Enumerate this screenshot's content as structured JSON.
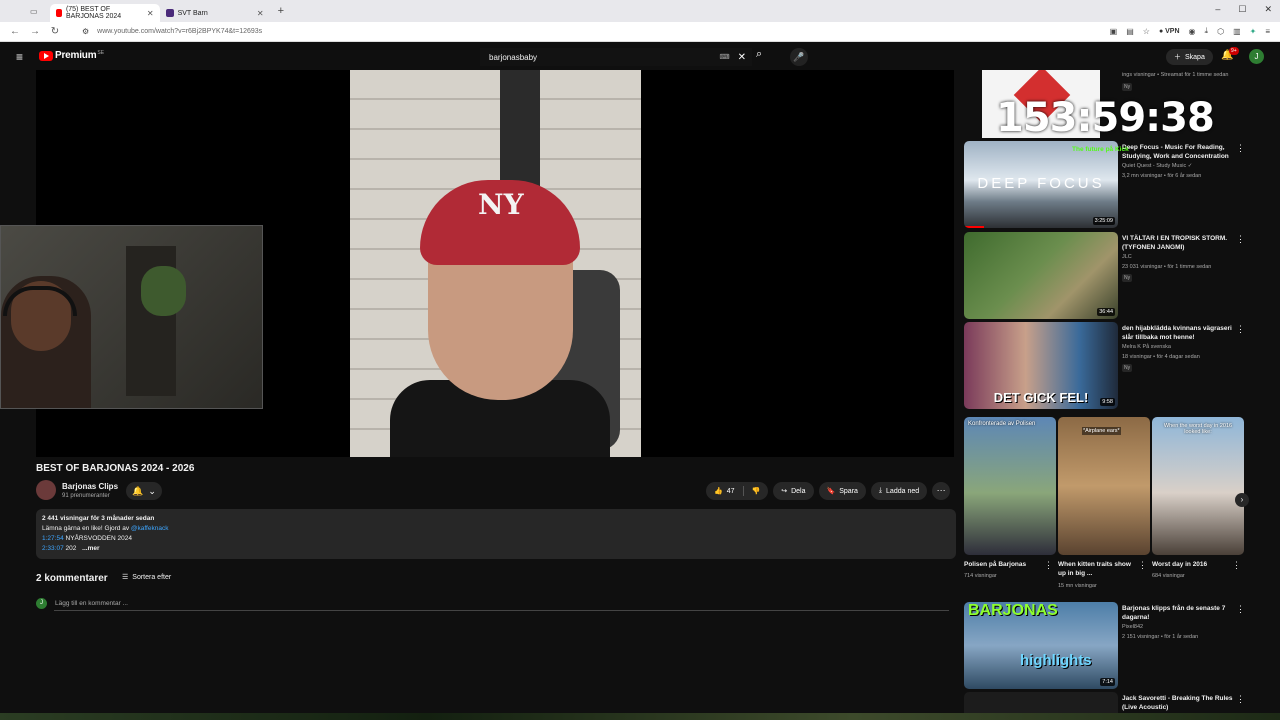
{
  "browser": {
    "tabs": [
      {
        "label": "(75) BEST OF BARJONAS 2024",
        "active": true,
        "color": "#ff0000"
      },
      {
        "label": "SVT Barn",
        "active": false,
        "color": "#4a2a7a"
      }
    ],
    "url": "www.youtube.com/watch?v=r6Bj2BPYK74&t=12693s",
    "vpn_label": "VPN"
  },
  "yt": {
    "logo_text": "Premium",
    "logo_region": "SE",
    "search_value": "barjonasbaby",
    "create_label": "Skapa",
    "notif_count": "9+",
    "avatar_letter": "J"
  },
  "overlay": {
    "timer": "153:59:38",
    "kick_label": "The future på Kick"
  },
  "video": {
    "title": "BEST OF BARJONAS 2024 - 2026",
    "channel": "Barjonas Clips",
    "subscribers": "91 prenumeranter",
    "likes": "47",
    "share_label": "Dela",
    "save_label": "Spara",
    "download_label": "Ladda ned",
    "desc_meta": "2 441 visningar  för 3 månader sedan",
    "desc_line1": "Lämna gärna en like! Gjord av ",
    "desc_line1_link": "@kaffeknack",
    "desc_ts1": "1:27:54",
    "desc_ts1_text": " NYÅRSVODDEN 2024",
    "desc_ts2": "2:33:07",
    "desc_ts2_text": " 202",
    "desc_more": "...mer"
  },
  "comments": {
    "count_label": "2 kommentarer",
    "sort_label": "Sortera efter",
    "add_placeholder": "Lägg till en kommentar ...",
    "avatar_letter": "J"
  },
  "sidebar": {
    "top_partial": {
      "views": "ings visningar • Streamat för 1 timme sedan",
      "badge": "Ny"
    },
    "videos": [
      {
        "title": "Deep Focus - Music For Reading, Studying, Work and Concentration",
        "channel": "Quiet Quest - Study Music ✓",
        "views": "3,2 mn visningar • för 6 år sedan",
        "duration": "3:25:09",
        "thumb_text": "DEEP FOCUS",
        "badge": ""
      },
      {
        "title": "VI TÄLTAR I EN TROPISK STORM. (TYFONEN JANGMI)",
        "channel": "JLC",
        "views": "23 031 visningar • för 1 timme sedan",
        "duration": "36:44",
        "thumb_text": "",
        "badge": "Ny"
      },
      {
        "title": "den hijabklädda kvinnans vägraseri slår tillbaka mot henne!",
        "channel": "Melra K På svenska",
        "views": "18 visningar • för 4 dagar sedan",
        "duration": "9:58",
        "thumb_text": "DET GICK FEL!",
        "badge": "Ny"
      }
    ],
    "shorts": [
      {
        "title": "Polisen på Barjonas",
        "views": "714 visningar",
        "overlay": "Konfronterade av Polisen"
      },
      {
        "title": "When kitten traits show up in big ...",
        "views": "15 mn visningar",
        "overlay": "*Airplane ears*"
      },
      {
        "title": "Worst day in 2016",
        "views": "684 visningar",
        "overlay": "When the worst day in 2016 looked like:"
      }
    ],
    "bottom_videos": [
      {
        "title": "Barjonas klipps från de senaste 7 dagarna!",
        "channel": "Pixel842",
        "views": "2 151 visningar • för 1 år sedan",
        "duration": "7:14",
        "thumb_text_top": "BARJONAS",
        "thumb_text_bottom": "highlights"
      },
      {
        "title": "Jack Savoretti - Breaking The Rules (Live Acoustic)"
      }
    ]
  }
}
